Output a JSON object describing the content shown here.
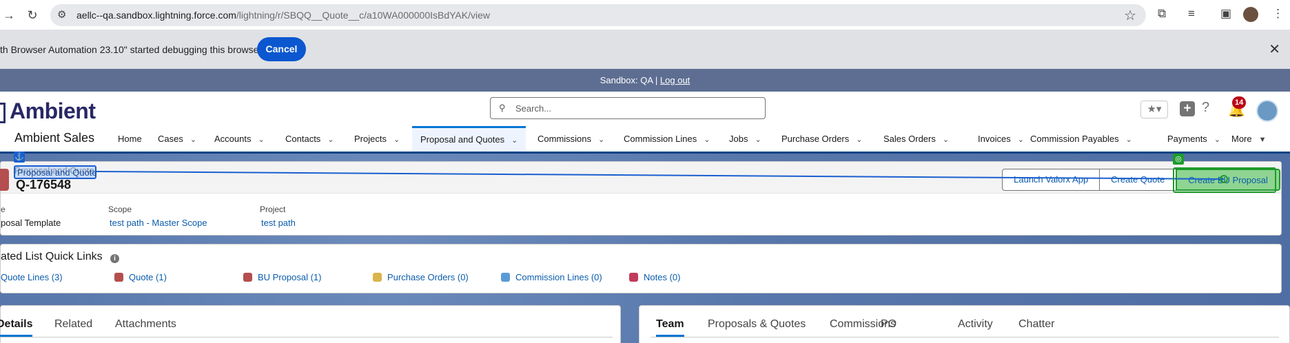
{
  "browser": {
    "url_host": "aellc--qa.sandbox.lightning.force.com",
    "url_path": "/lightning/r/SBQQ__Quote__c/a10WA000000IsBdYAK/view"
  },
  "debug_bar": {
    "message": "th Browser Automation 23.10\" started debugging this browser",
    "cancel_label": "Cancel"
  },
  "sandbox_banner": {
    "label": "Sandbox: QA |",
    "logout_label": "Log out"
  },
  "header": {
    "logo_text": "Ambient",
    "search_placeholder": "Search...",
    "notification_count": "14"
  },
  "nav": {
    "app_name": "Ambient Sales",
    "items": [
      {
        "label": "Home",
        "has_menu": false
      },
      {
        "label": "Cases",
        "has_menu": true
      },
      {
        "label": "Accounts",
        "has_menu": true
      },
      {
        "label": "Contacts",
        "has_menu": true
      },
      {
        "label": "Projects",
        "has_menu": true
      },
      {
        "label": "Proposal and Quotes",
        "has_menu": true,
        "active": true
      },
      {
        "label": "Commissions",
        "has_menu": true
      },
      {
        "label": "Commission Lines",
        "has_menu": true
      },
      {
        "label": "Jobs",
        "has_menu": true
      },
      {
        "label": "Purchase Orders",
        "has_menu": true
      },
      {
        "label": "Sales Orders",
        "has_menu": true
      },
      {
        "label": "Invoices",
        "has_menu": true
      },
      {
        "label": "Commission Payables",
        "has_menu": true
      },
      {
        "label": "Payments",
        "has_menu": true
      },
      {
        "label": "More",
        "has_menu": true
      }
    ]
  },
  "record": {
    "object_label": "Proposal and Quote",
    "name": "Q-176548",
    "fields": [
      {
        "label": "e",
        "value": "posal Template",
        "is_link": false
      },
      {
        "label": "Scope",
        "value": "test path - Master Scope",
        "is_link": true
      },
      {
        "label": "Project",
        "value": "test path",
        "is_link": true
      }
    ],
    "actions": [
      "Launch Valorx App",
      "Create Quote",
      "Create BU Proposal"
    ]
  },
  "quick_links": {
    "title": "ated List Quick Links",
    "items": [
      {
        "label": "Quote Lines (3)",
        "color": "#ffffff"
      },
      {
        "label": "Quote (1)",
        "color": "#b54e4e"
      },
      {
        "label": "BU Proposal (1)",
        "color": "#b54e4e"
      },
      {
        "label": "Purchase Orders (0)",
        "color": "#d9b44a"
      },
      {
        "label": "Commission Lines (0)",
        "color": "#5b9bd5"
      },
      {
        "label": "Notes (0)",
        "color": "#c23b5a"
      }
    ]
  },
  "left_tabs": [
    "Details",
    "Related",
    "Attachments"
  ],
  "right_tabs": [
    "Team",
    "Proposals & Quotes",
    "Commissions",
    "PO",
    "Activity",
    "Chatter"
  ],
  "colors": {
    "brand_blue": "#0176d3",
    "banner": "#5e6e92",
    "highlight_green": "#8fd492",
    "automation_blue": "#1a5fd0"
  }
}
